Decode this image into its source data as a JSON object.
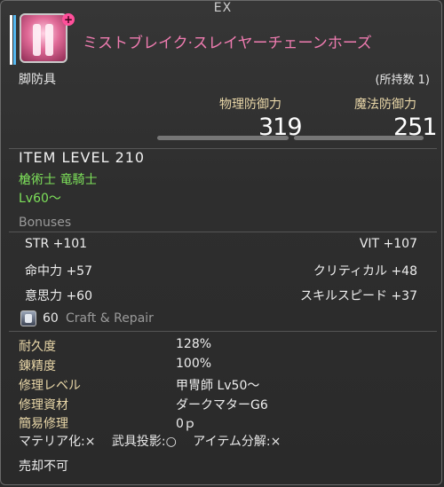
{
  "header": {
    "ex_label": "EX",
    "item_name": "ミストブレイク·スレイヤーチェーンホーズ",
    "icon": "leg-armor-icon",
    "badge": "+"
  },
  "slot_label": "脚防具",
  "owned_count": "(所持数 1)",
  "stats": {
    "physical_label": "物理防御力",
    "physical_value": "319",
    "magic_label": "魔法防御力",
    "magic_value": "251"
  },
  "item_level": "ITEM LEVEL 210",
  "jobs": "槍術士 竜騎士",
  "level_req": "Lv60～",
  "bonuses_title": "Bonuses",
  "bonuses": {
    "str": "STR +101",
    "vit": "VIT +107",
    "dh": "命中力 +57",
    "crit": "クリティカル +48",
    "det": "意思力 +60",
    "sks": "スキルスピード +37"
  },
  "craft": {
    "icon": "craft-repair-icon",
    "level": "60",
    "title": "Craft & Repair",
    "rows": [
      {
        "key": "耐久度",
        "value": "128%"
      },
      {
        "key": "錬精度",
        "value": "100%"
      },
      {
        "key": "修理レベル",
        "value": "甲冑師 Lv50～"
      },
      {
        "key": "修理資材",
        "value": "ダークマターG6"
      },
      {
        "key": "簡易修理",
        "value": "0ｐ"
      }
    ]
  },
  "flags": {
    "materia": "マテリア化:×",
    "glamour": "武具投影:○",
    "desynth": "アイテム分解:×"
  },
  "unsellable": "売却不可",
  "colors": {
    "item_name": "#f07cb1",
    "job_text": "#7de05a",
    "key_text": "#e9d7a8"
  }
}
